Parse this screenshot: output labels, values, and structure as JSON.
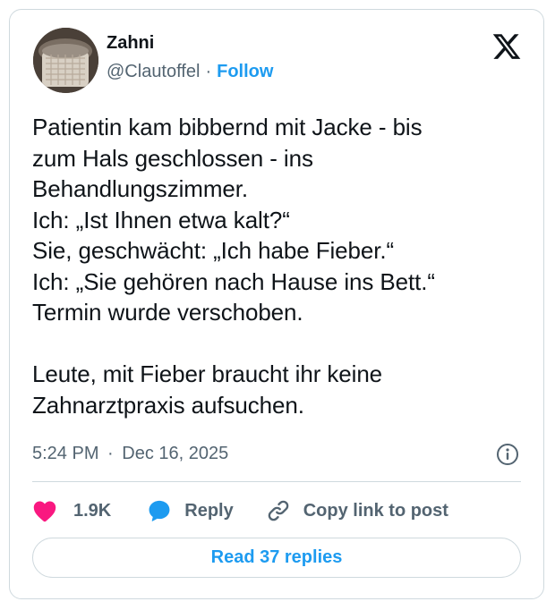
{
  "author": {
    "name": "Zahni",
    "handle": "@Clautoffel",
    "separator": "·",
    "follow_label": "Follow",
    "avatar_icon": "avatar-mug-photo"
  },
  "platform_icon": "x-logo-icon",
  "tweet": {
    "text": "Patientin kam bibbernd mit Jacke - bis\nzum Hals geschlossen - ins\nBehandlungszimmer.\nIch: „Ist Ihnen etwa kalt?“\nSie, geschwächt: „Ich habe Fieber.“\nIch: „Sie gehören nach Hause ins Bett.“\nTermin wurde verschoben.\n\nLeute, mit Fieber braucht ihr keine\nZahnarztpraxis aufsuchen.",
    "time": "5:24 PM",
    "separator": "·",
    "date": "Dec 16, 2025"
  },
  "actions": {
    "likes": "1.9K",
    "reply_label": "Reply",
    "copy_label": "Copy link to post"
  },
  "read_replies_label": "Read 37 replies",
  "colors": {
    "accent": "#1d9bf0",
    "like": "#f91880",
    "text": "#0f1419",
    "secondary": "#536471",
    "border": "#cfd9de"
  }
}
